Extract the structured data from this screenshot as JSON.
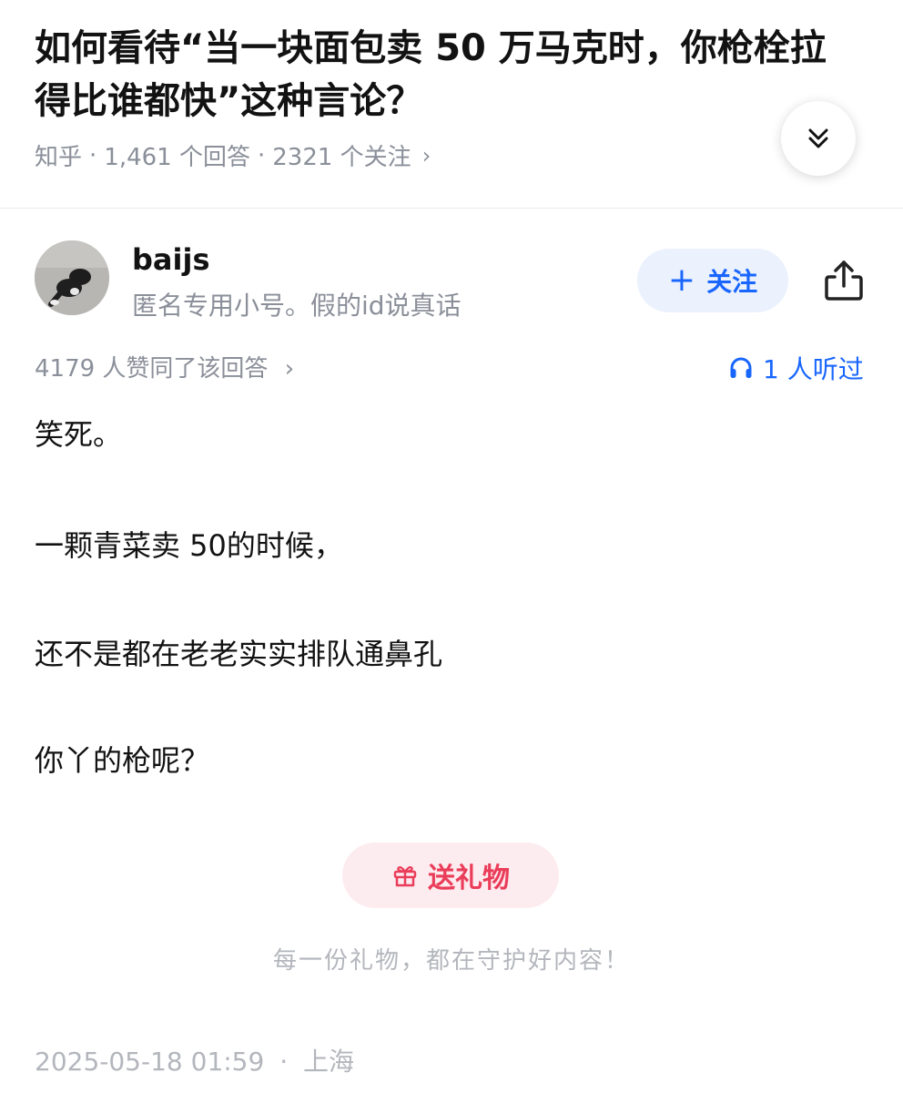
{
  "question": {
    "title": "如何看待“当一块面包卖 50 万马克时，你枪栓拉得比谁都快”这种言论？",
    "source": "知乎",
    "answers_count": "1,461 个回答",
    "followers_count": "2321 个关注",
    "separator": "·",
    "chevron": "›"
  },
  "author": {
    "name": "baijs",
    "bio": "匿名专用小号。假的id说真话",
    "follow_label": "关注",
    "follow_plus": "+"
  },
  "answer": {
    "votes_text": "4179 人赞同了该回答",
    "listen_text": "1 人听过",
    "paragraphs": [
      "笑死。",
      "一颗青菜卖 50的时候，",
      "还不是都在老老实实排队通鼻孔",
      "你丫的枪呢？"
    ],
    "gift_label": "送礼物",
    "gift_note": "每一份礼物，都在守护好内容！",
    "date": "2025-05-18 01:59",
    "location": "上海"
  },
  "icons": {
    "expand": "double-chevron-down-icon",
    "share": "share-icon",
    "headphones": "headphones-icon",
    "gift": "gift-icon"
  },
  "colors": {
    "accent_blue": "#1966ff",
    "follow_bg": "#ebf1fd",
    "gift_red": "#ea3d5a",
    "gift_bg": "#fdecef",
    "meta_gray": "#8a8f99"
  }
}
